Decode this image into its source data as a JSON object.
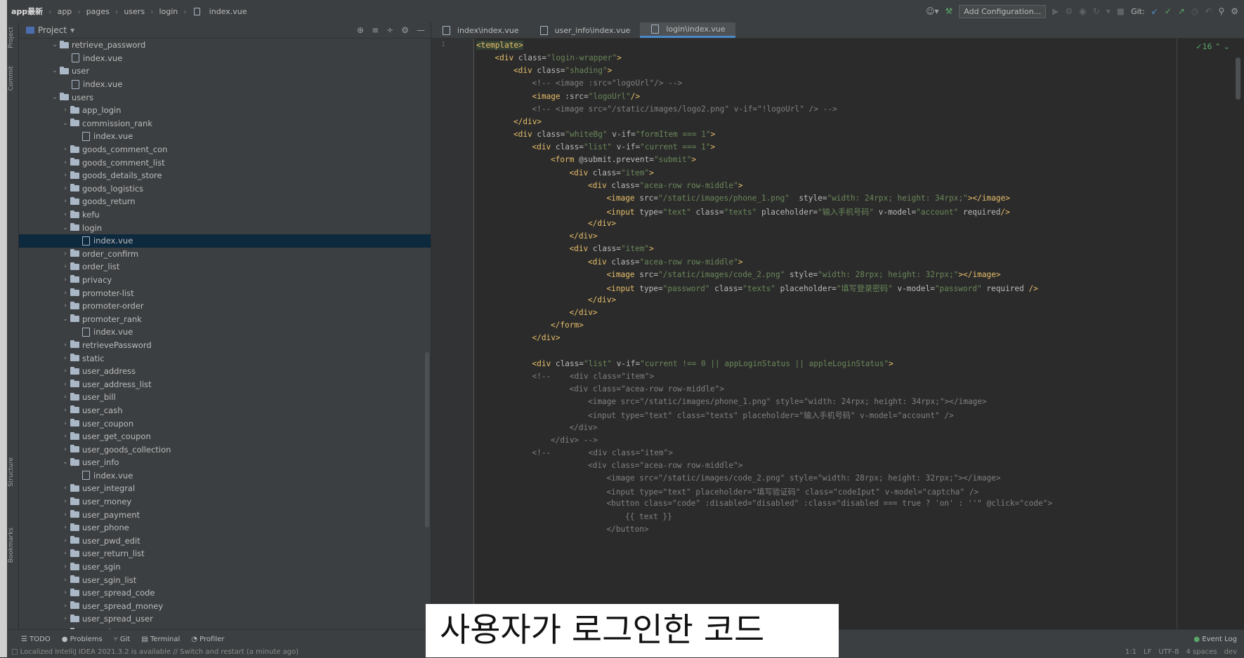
{
  "breadcrumb": [
    "app最新",
    "app",
    "pages",
    "users",
    "login",
    "index.vue"
  ],
  "toolbar": {
    "add_config": "Add Configuration...",
    "git_label": "Git:"
  },
  "stripe_labels": {
    "project": "Project",
    "commit": "Commit",
    "structure": "Structure",
    "bookmarks": "Bookmarks"
  },
  "project_panel": {
    "title": "Project"
  },
  "tree": [
    {
      "name": "retrieve_password",
      "type": "folder",
      "depth": 0,
      "expanded": true
    },
    {
      "name": "index.vue",
      "type": "file",
      "depth": 1
    },
    {
      "name": "user",
      "type": "folder",
      "depth": 0,
      "expanded": true
    },
    {
      "name": "index.vue",
      "type": "file",
      "depth": 1
    },
    {
      "name": "users",
      "type": "folder",
      "depth": 0,
      "expanded": true
    },
    {
      "name": "app_login",
      "type": "folder",
      "depth": 1,
      "expanded": false
    },
    {
      "name": "commission_rank",
      "type": "folder",
      "depth": 1,
      "expanded": true
    },
    {
      "name": "index.vue",
      "type": "file",
      "depth": 2
    },
    {
      "name": "goods_comment_con",
      "type": "folder",
      "depth": 1,
      "expanded": false
    },
    {
      "name": "goods_comment_list",
      "type": "folder",
      "depth": 1,
      "expanded": false
    },
    {
      "name": "goods_details_store",
      "type": "folder",
      "depth": 1,
      "expanded": false
    },
    {
      "name": "goods_logistics",
      "type": "folder",
      "depth": 1,
      "expanded": false
    },
    {
      "name": "goods_return",
      "type": "folder",
      "depth": 1,
      "expanded": false
    },
    {
      "name": "kefu",
      "type": "folder",
      "depth": 1,
      "expanded": false
    },
    {
      "name": "login",
      "type": "folder",
      "depth": 1,
      "expanded": true
    },
    {
      "name": "index.vue",
      "type": "file",
      "depth": 2,
      "selected": true
    },
    {
      "name": "order_confirm",
      "type": "folder",
      "depth": 1,
      "expanded": false
    },
    {
      "name": "order_list",
      "type": "folder",
      "depth": 1,
      "expanded": false
    },
    {
      "name": "privacy",
      "type": "folder",
      "depth": 1,
      "expanded": false
    },
    {
      "name": "promoter-list",
      "type": "folder",
      "depth": 1,
      "expanded": false
    },
    {
      "name": "promoter-order",
      "type": "folder",
      "depth": 1,
      "expanded": false
    },
    {
      "name": "promoter_rank",
      "type": "folder",
      "depth": 1,
      "expanded": true
    },
    {
      "name": "index.vue",
      "type": "file",
      "depth": 2
    },
    {
      "name": "retrievePassword",
      "type": "folder",
      "depth": 1,
      "expanded": false
    },
    {
      "name": "static",
      "type": "folder",
      "depth": 1,
      "expanded": false
    },
    {
      "name": "user_address",
      "type": "folder",
      "depth": 1,
      "expanded": false
    },
    {
      "name": "user_address_list",
      "type": "folder",
      "depth": 1,
      "expanded": false
    },
    {
      "name": "user_bill",
      "type": "folder",
      "depth": 1,
      "expanded": false
    },
    {
      "name": "user_cash",
      "type": "folder",
      "depth": 1,
      "expanded": false
    },
    {
      "name": "user_coupon",
      "type": "folder",
      "depth": 1,
      "expanded": false
    },
    {
      "name": "user_get_coupon",
      "type": "folder",
      "depth": 1,
      "expanded": false
    },
    {
      "name": "user_goods_collection",
      "type": "folder",
      "depth": 1,
      "expanded": false
    },
    {
      "name": "user_info",
      "type": "folder",
      "depth": 1,
      "expanded": true
    },
    {
      "name": "index.vue",
      "type": "file",
      "depth": 2
    },
    {
      "name": "user_integral",
      "type": "folder",
      "depth": 1,
      "expanded": false
    },
    {
      "name": "user_money",
      "type": "folder",
      "depth": 1,
      "expanded": false
    },
    {
      "name": "user_payment",
      "type": "folder",
      "depth": 1,
      "expanded": false
    },
    {
      "name": "user_phone",
      "type": "folder",
      "depth": 1,
      "expanded": false
    },
    {
      "name": "user_pwd_edit",
      "type": "folder",
      "depth": 1,
      "expanded": false
    },
    {
      "name": "user_return_list",
      "type": "folder",
      "depth": 1,
      "expanded": false
    },
    {
      "name": "user_sgin",
      "type": "folder",
      "depth": 1,
      "expanded": false
    },
    {
      "name": "user_sgin_list",
      "type": "folder",
      "depth": 1,
      "expanded": false
    },
    {
      "name": "user_spread_code",
      "type": "folder",
      "depth": 1,
      "expanded": false
    },
    {
      "name": "user_spread_money",
      "type": "folder",
      "depth": 1,
      "expanded": false
    },
    {
      "name": "user_spread_user",
      "type": "folder",
      "depth": 1,
      "expanded": false
    },
    {
      "name": "user_vip",
      "type": "folder",
      "depth": 1,
      "expanded": false
    }
  ],
  "editor_tabs": [
    {
      "label": "index\\index.vue",
      "active": false
    },
    {
      "label": "user_info\\index.vue",
      "active": false
    },
    {
      "label": "login\\index.vue",
      "active": true
    }
  ],
  "inspection_count": "16",
  "line_number_first": "1",
  "code_lines": [
    {
      "indent": 0,
      "parts": [
        {
          "c": "tk",
          "t": "<template>"
        }
      ]
    },
    {
      "indent": 1,
      "parts": [
        {
          "c": "tg",
          "t": "<div "
        },
        {
          "c": "an",
          "t": "class="
        },
        {
          "c": "av",
          "t": "\"login-wrapper\""
        },
        {
          "c": "tg",
          "t": ">"
        }
      ]
    },
    {
      "indent": 2,
      "parts": [
        {
          "c": "tg",
          "t": "<div "
        },
        {
          "c": "an",
          "t": "class="
        },
        {
          "c": "av",
          "t": "\"shading\""
        },
        {
          "c": "tg",
          "t": ">"
        }
      ]
    },
    {
      "indent": 3,
      "parts": [
        {
          "c": "cm",
          "t": "<!-- <image :src=\"logoUrl\"/> -->"
        }
      ]
    },
    {
      "indent": 3,
      "parts": [
        {
          "c": "tg",
          "t": "<image "
        },
        {
          "c": "an",
          "t": ":src="
        },
        {
          "c": "av",
          "t": "\"logoUrl\""
        },
        {
          "c": "tg",
          "t": "/>"
        }
      ]
    },
    {
      "indent": 3,
      "parts": [
        {
          "c": "cm",
          "t": "<!-- <image src=\"/static/images/logo2.png\" v-if=\"!logoUrl\" /> -->"
        }
      ]
    },
    {
      "indent": 2,
      "parts": [
        {
          "c": "tg",
          "t": "</div>"
        }
      ]
    },
    {
      "indent": 2,
      "parts": [
        {
          "c": "tg",
          "t": "<div "
        },
        {
          "c": "an",
          "t": "class="
        },
        {
          "c": "av",
          "t": "\"whiteBg\" "
        },
        {
          "c": "an",
          "t": "v-if="
        },
        {
          "c": "av",
          "t": "\"formItem === 1\""
        },
        {
          "c": "tg",
          "t": ">"
        }
      ]
    },
    {
      "indent": 3,
      "parts": [
        {
          "c": "tg",
          "t": "<div "
        },
        {
          "c": "an",
          "t": "class="
        },
        {
          "c": "av",
          "t": "\"list\" "
        },
        {
          "c": "an",
          "t": "v-if="
        },
        {
          "c": "av",
          "t": "\"current === 1\""
        },
        {
          "c": "tg",
          "t": ">"
        }
      ]
    },
    {
      "indent": 4,
      "parts": [
        {
          "c": "tg",
          "t": "<form "
        },
        {
          "c": "an",
          "t": "@submit.prevent="
        },
        {
          "c": "av",
          "t": "\"submit\""
        },
        {
          "c": "tg",
          "t": ">"
        }
      ]
    },
    {
      "indent": 5,
      "parts": [
        {
          "c": "tg",
          "t": "<div "
        },
        {
          "c": "an",
          "t": "class="
        },
        {
          "c": "av",
          "t": "\"item\""
        },
        {
          "c": "tg",
          "t": ">"
        }
      ]
    },
    {
      "indent": 6,
      "parts": [
        {
          "c": "tg",
          "t": "<div "
        },
        {
          "c": "an",
          "t": "class="
        },
        {
          "c": "av",
          "t": "\"acea-row row-middle\""
        },
        {
          "c": "tg",
          "t": ">"
        }
      ]
    },
    {
      "indent": 7,
      "parts": [
        {
          "c": "tg",
          "t": "<image "
        },
        {
          "c": "an",
          "t": "src="
        },
        {
          "c": "av",
          "t": "\"/static/images/phone_1.png\"  "
        },
        {
          "c": "an",
          "t": "style="
        },
        {
          "c": "av",
          "t": "\"width: 24rpx; height: 34rpx;\""
        },
        {
          "c": "tg",
          "t": "></image>"
        }
      ]
    },
    {
      "indent": 7,
      "parts": [
        {
          "c": "tg",
          "t": "<input "
        },
        {
          "c": "an",
          "t": "type="
        },
        {
          "c": "av",
          "t": "\"text\" "
        },
        {
          "c": "an",
          "t": "class="
        },
        {
          "c": "av",
          "t": "\"texts\" "
        },
        {
          "c": "an",
          "t": "placeholder="
        },
        {
          "c": "av",
          "t": "\"输入手机号码\" "
        },
        {
          "c": "an",
          "t": "v-model="
        },
        {
          "c": "av",
          "t": "\"account\" "
        },
        {
          "c": "an",
          "t": "required"
        },
        {
          "c": "tg",
          "t": "/>"
        }
      ]
    },
    {
      "indent": 6,
      "parts": [
        {
          "c": "tg",
          "t": "</div>"
        }
      ]
    },
    {
      "indent": 5,
      "parts": [
        {
          "c": "tg",
          "t": "</div>"
        }
      ]
    },
    {
      "indent": 5,
      "parts": [
        {
          "c": "tg",
          "t": "<div "
        },
        {
          "c": "an",
          "t": "class="
        },
        {
          "c": "av",
          "t": "\"item\""
        },
        {
          "c": "tg",
          "t": ">"
        }
      ]
    },
    {
      "indent": 6,
      "parts": [
        {
          "c": "tg",
          "t": "<div "
        },
        {
          "c": "an",
          "t": "class="
        },
        {
          "c": "av",
          "t": "\"acea-row row-middle\""
        },
        {
          "c": "tg",
          "t": ">"
        }
      ]
    },
    {
      "indent": 7,
      "parts": [
        {
          "c": "tg",
          "t": "<image "
        },
        {
          "c": "an",
          "t": "src="
        },
        {
          "c": "av",
          "t": "\"/static/images/code_2.png\" "
        },
        {
          "c": "an",
          "t": "style="
        },
        {
          "c": "av",
          "t": "\"width: 28rpx; height: 32rpx;\""
        },
        {
          "c": "tg",
          "t": "></image>"
        }
      ]
    },
    {
      "indent": 7,
      "parts": [
        {
          "c": "tg",
          "t": "<input "
        },
        {
          "c": "an",
          "t": "type="
        },
        {
          "c": "av",
          "t": "\"password\" "
        },
        {
          "c": "an",
          "t": "class="
        },
        {
          "c": "av",
          "t": "\"texts\" "
        },
        {
          "c": "an",
          "t": "placeholder="
        },
        {
          "c": "av",
          "t": "\"填写登录密码\" "
        },
        {
          "c": "an",
          "t": "v-model="
        },
        {
          "c": "av",
          "t": "\"password\" "
        },
        {
          "c": "an",
          "t": "required "
        },
        {
          "c": "tg",
          "t": "/>"
        }
      ]
    },
    {
      "indent": 6,
      "parts": [
        {
          "c": "tg",
          "t": "</div>"
        }
      ]
    },
    {
      "indent": 5,
      "parts": [
        {
          "c": "tg",
          "t": "</div>"
        }
      ]
    },
    {
      "indent": 4,
      "parts": [
        {
          "c": "tg",
          "t": "</form>"
        }
      ]
    },
    {
      "indent": 3,
      "parts": [
        {
          "c": "tg",
          "t": "</div>"
        }
      ]
    },
    {
      "indent": 0,
      "parts": [
        {
          "c": "tx",
          "t": ""
        }
      ]
    },
    {
      "indent": 3,
      "parts": [
        {
          "c": "tg",
          "t": "<div "
        },
        {
          "c": "an",
          "t": "class="
        },
        {
          "c": "av",
          "t": "\"list\" "
        },
        {
          "c": "an",
          "t": "v-if="
        },
        {
          "c": "av",
          "t": "\"current !== 0 || appLoginStatus || appleLoginStatus\""
        },
        {
          "c": "tg",
          "t": ">"
        }
      ]
    },
    {
      "indent": 3,
      "parts": [
        {
          "c": "cm",
          "t": "<!--    <div class=\"item\">"
        }
      ]
    },
    {
      "indent": 5,
      "parts": [
        {
          "c": "cm",
          "t": "<div class=\"acea-row row-middle\">"
        }
      ]
    },
    {
      "indent": 6,
      "parts": [
        {
          "c": "cm",
          "t": "<image src=\"/static/images/phone_1.png\" style=\"width: 24rpx; height: 34rpx;\"></image>"
        }
      ]
    },
    {
      "indent": 6,
      "parts": [
        {
          "c": "cm",
          "t": "<input type=\"text\" class=\"texts\" placeholder=\"输入手机号码\" v-model=\"account\" />"
        }
      ]
    },
    {
      "indent": 5,
      "parts": [
        {
          "c": "cm",
          "t": "</div>"
        }
      ]
    },
    {
      "indent": 4,
      "parts": [
        {
          "c": "cm",
          "t": "</div> -->"
        }
      ]
    },
    {
      "indent": 3,
      "parts": [
        {
          "c": "cm",
          "t": "<!--        <div class=\"item\">"
        }
      ]
    },
    {
      "indent": 6,
      "parts": [
        {
          "c": "cm",
          "t": "<div class=\"acea-row row-middle\">"
        }
      ]
    },
    {
      "indent": 7,
      "parts": [
        {
          "c": "cm",
          "t": "<image src=\"/static/images/code_2.png\" style=\"width: 28rpx; height: 32rpx;\"></image>"
        }
      ]
    },
    {
      "indent": 7,
      "parts": [
        {
          "c": "cm",
          "t": "<input type=\"text\" placeholder=\"填写验证码\" class=\"codeIput\" v-model=\"captcha\" />"
        }
      ]
    },
    {
      "indent": 7,
      "parts": [
        {
          "c": "cm",
          "t": "<button class=\"code\" :disabled=\"disabled\" :class=\"disabled === true ? 'on' : ''\" @click=\"code\">"
        }
      ]
    },
    {
      "indent": 8,
      "parts": [
        {
          "c": "cm",
          "t": "{{ text }}"
        }
      ]
    },
    {
      "indent": 7,
      "parts": [
        {
          "c": "cm",
          "t": "</button>"
        }
      ]
    }
  ],
  "bottom_tools": [
    "TODO",
    "Problems",
    "Git",
    "Terminal",
    "Profiler"
  ],
  "event_log": "Event Log",
  "status_message": "Localized IntelliJ IDEA 2021.3.2 is available // Switch and restart (a minute ago)",
  "status_right": [
    "1:1",
    "LF",
    "UTF-8",
    "4 spaces",
    "dev"
  ],
  "subtitle": "사용자가 로그인한 코드",
  "colors": {
    "accent": "#4a88c7",
    "tag": "#e8bf6a",
    "attr_value": "#6a8759",
    "comment": "#808080"
  }
}
